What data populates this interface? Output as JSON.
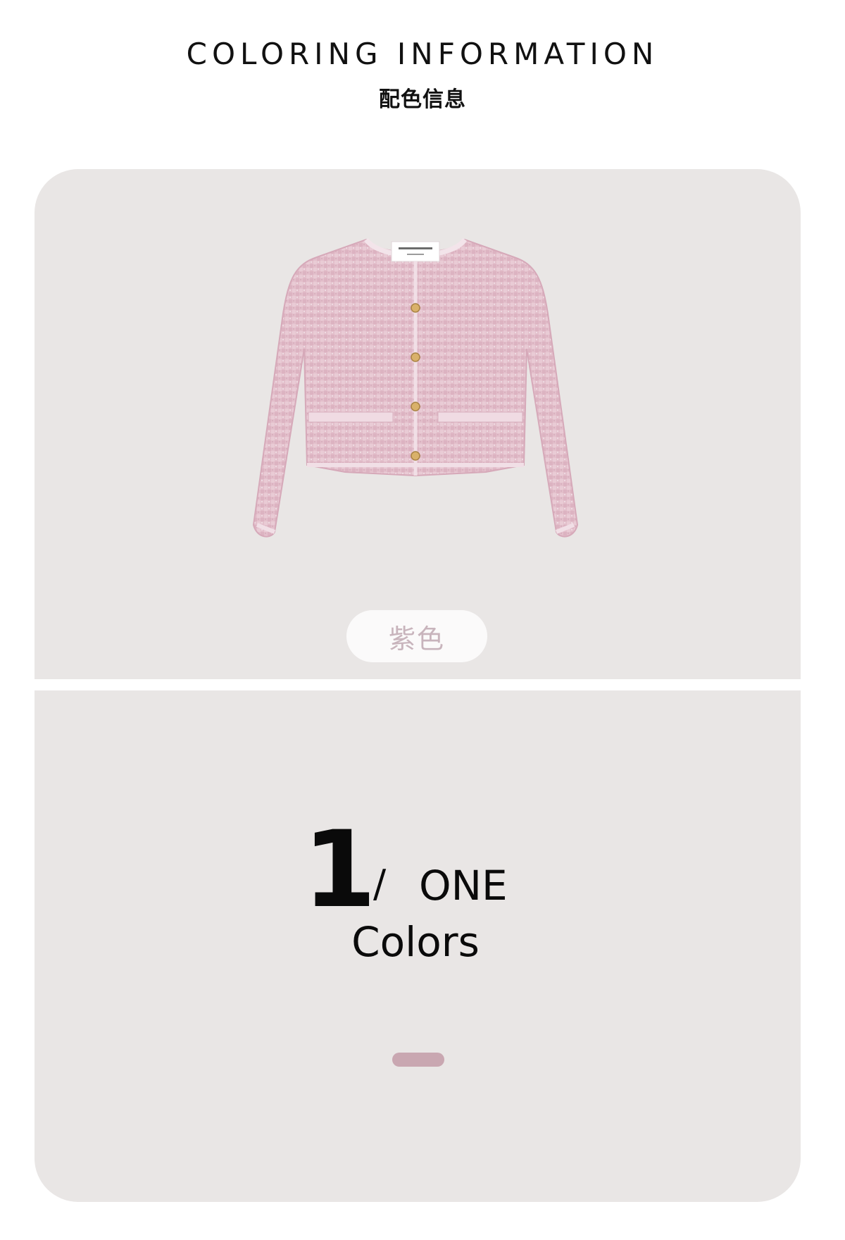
{
  "header": {
    "title_en": "COLORING INFORMATION",
    "title_cn": "配色信息"
  },
  "product": {
    "image": "pink-tweed-jacket",
    "color_name": "紫色",
    "color_label_hex": "#c8b4bc"
  },
  "summary": {
    "count_number": "1",
    "separator": "/",
    "count_word": "ONE",
    "unit": "Colors",
    "swatch_color": "#c9a7b1"
  }
}
